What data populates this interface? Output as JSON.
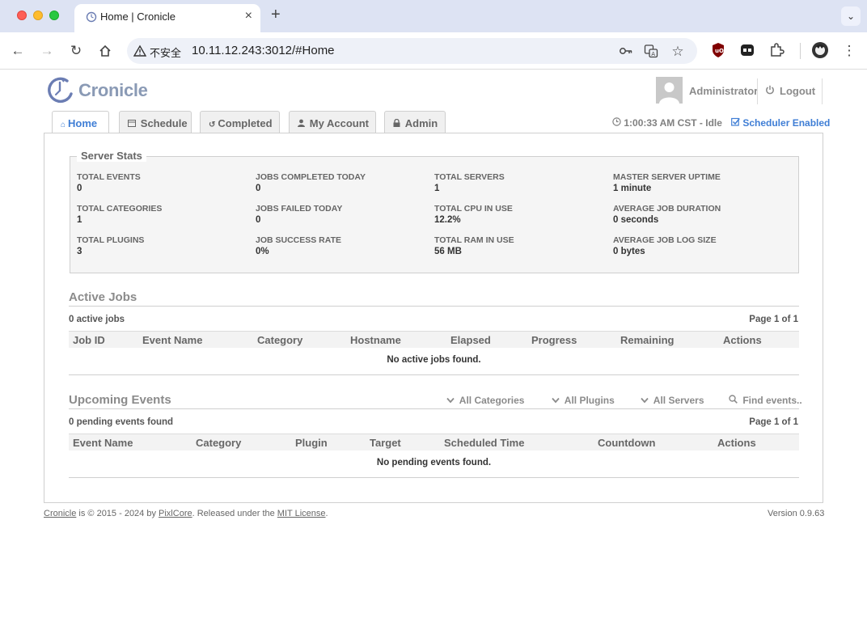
{
  "browser": {
    "tab_title": "Home | Cronicle",
    "new_tab_label": "+",
    "security_label": "不安全",
    "url": "10.11.12.243:3012/#Home"
  },
  "header": {
    "logo_text": "Cronicle",
    "user_name": "Administrator",
    "logout_label": "Logout"
  },
  "tabs": [
    {
      "label": "Home",
      "icon": "home-icon",
      "active": true
    },
    {
      "label": "Schedule",
      "icon": "calendar-icon"
    },
    {
      "label": "Completed",
      "icon": "history-icon"
    },
    {
      "label": "My Account",
      "icon": "user-icon"
    },
    {
      "label": "Admin",
      "icon": "lock-icon"
    }
  ],
  "status": {
    "clock": "1:00:33 AM CST - Idle",
    "scheduler": "Scheduler Enabled"
  },
  "server_stats": {
    "title": "Server Stats",
    "items": [
      {
        "label": "TOTAL EVENTS",
        "value": "0"
      },
      {
        "label": "JOBS COMPLETED TODAY",
        "value": "0"
      },
      {
        "label": "TOTAL SERVERS",
        "value": "1"
      },
      {
        "label": "MASTER SERVER UPTIME",
        "value": "1 minute"
      },
      {
        "label": "TOTAL CATEGORIES",
        "value": "1"
      },
      {
        "label": "JOBS FAILED TODAY",
        "value": "0"
      },
      {
        "label": "TOTAL CPU IN USE",
        "value": "12.2%"
      },
      {
        "label": "AVERAGE JOB DURATION",
        "value": "0 seconds"
      },
      {
        "label": "TOTAL PLUGINS",
        "value": "3"
      },
      {
        "label": "JOB SUCCESS RATE",
        "value": "0%"
      },
      {
        "label": "TOTAL RAM IN USE",
        "value": "56 MB"
      },
      {
        "label": "AVERAGE JOB LOG SIZE",
        "value": "0 bytes"
      }
    ]
  },
  "active_jobs": {
    "title": "Active Jobs",
    "count_text": "0 active jobs",
    "page_text": "Page 1 of 1",
    "columns": [
      "Job ID",
      "Event Name",
      "Category",
      "Hostname",
      "Elapsed",
      "Progress",
      "Remaining",
      "Actions"
    ],
    "empty_text": "No active jobs found."
  },
  "upcoming_events": {
    "title": "Upcoming Events",
    "filters": {
      "categories": "All Categories",
      "plugins": "All Plugins",
      "servers": "All Servers",
      "search_placeholder": "Find events.."
    },
    "count_text": "0 pending events found",
    "page_text": "Page 1 of 1",
    "columns": [
      "Event Name",
      "Category",
      "Plugin",
      "Target",
      "Scheduled Time",
      "Countdown",
      "Actions"
    ],
    "empty_text": "No pending events found."
  },
  "footer": {
    "app_link": "Cronicle",
    "copyright_text": " is © 2015 - 2024 by ",
    "company_link": "PixlCore",
    "released_text": ". Released under the ",
    "license_link": "MIT License",
    "period": ".",
    "version": "Version 0.9.63"
  },
  "colors": {
    "accent": "#3f7ed5",
    "logo": "#8a9ab5",
    "chrome_bar": "#dde3f3"
  }
}
